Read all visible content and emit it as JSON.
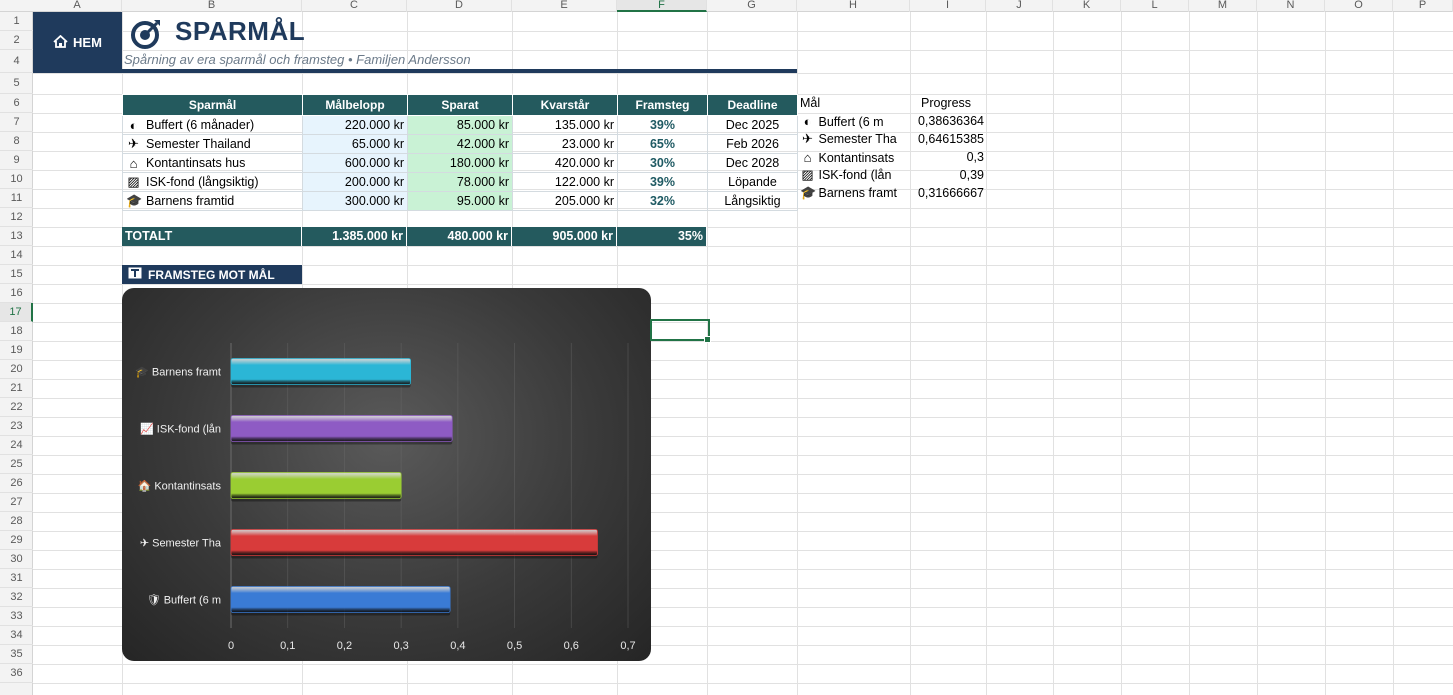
{
  "columns": [
    "A",
    "B",
    "C",
    "D",
    "E",
    "F",
    "G",
    "H",
    "I",
    "J",
    "K",
    "L",
    "M",
    "N",
    "O",
    "P"
  ],
  "selected_column": "F",
  "rows": [
    "1",
    "2",
    "4",
    "5",
    "6",
    "7",
    "8",
    "9",
    "10",
    "11",
    "12",
    "13",
    "14",
    "15",
    "16",
    "17",
    "18",
    "19",
    "20",
    "21",
    "22",
    "23",
    "24",
    "25",
    "26",
    "27",
    "28",
    "29",
    "30",
    "31",
    "32",
    "33",
    "34",
    "35",
    "36"
  ],
  "selected_row": "17",
  "header": {
    "home_label": "HEM",
    "home_icon": "home-icon",
    "title": "SPARMÅL",
    "title_icon": "target-icon",
    "subtitle": "Spårning av era sparmål och framsteg • Familjen Andersson"
  },
  "goals_table": {
    "headers": [
      "Sparmål",
      "Målbelopp",
      "Sparat",
      "Kvarstår",
      "Framsteg",
      "Deadline"
    ],
    "rows": [
      {
        "icon": "shield-icon",
        "glyph": "◐",
        "name": "Buffert (6 månader)",
        "target": "220.000 kr",
        "saved": "85.000 kr",
        "remaining": "135.000 kr",
        "progress": "39%",
        "deadline": "Dec 2025"
      },
      {
        "icon": "airplane-icon",
        "glyph": "✈",
        "name": "Semester Thailand",
        "target": "65.000 kr",
        "saved": "42.000 kr",
        "remaining": "23.000 kr",
        "progress": "65%",
        "deadline": "Feb 2026"
      },
      {
        "icon": "house-icon",
        "glyph": "⌂",
        "name": "Kontantinsats hus",
        "target": "600.000 kr",
        "saved": "180.000 kr",
        "remaining": "420.000 kr",
        "progress": "30%",
        "deadline": "Dec 2028"
      },
      {
        "icon": "chart-icon",
        "glyph": "▨",
        "name": "ISK-fond (långsiktig)",
        "target": "200.000 kr",
        "saved": "78.000 kr",
        "remaining": "122.000 kr",
        "progress": "39%",
        "deadline": "Löpande"
      },
      {
        "icon": "graduation-cap-icon",
        "glyph": "🎓",
        "name": "Barnens framtid",
        "target": "300.000 kr",
        "saved": "95.000 kr",
        "remaining": "205.000 kr",
        "progress": "32%",
        "deadline": "Långsiktig"
      }
    ]
  },
  "totals": {
    "label": "TOTALT",
    "target": "1.385.000 kr",
    "saved": "480.000 kr",
    "remaining": "905.000 kr",
    "progress": "35%"
  },
  "helper_table": {
    "headers": [
      "Mål",
      "Progress"
    ],
    "rows": [
      {
        "glyph": "◐",
        "name": "Buffert (6 m",
        "value": "0,38636364"
      },
      {
        "glyph": "✈",
        "name": "Semester Tha",
        "value": "0,64615385"
      },
      {
        "glyph": "⌂",
        "name": "Kontantinsats",
        "value": "0,3"
      },
      {
        "glyph": "▨",
        "name": "ISK-fond (lån",
        "value": "0,39"
      },
      {
        "glyph": "🎓",
        "name": "Barnens framt",
        "value": "0,31666667"
      }
    ]
  },
  "section": {
    "label": "FRAMSTEG MOT MÅL",
    "icon": "chart-box-icon"
  },
  "chart_data": {
    "type": "bar",
    "orientation": "horizontal",
    "categories": [
      "Buffert (6 m",
      "Semester Tha",
      "Kontantinsats",
      "ISK-fond (lån",
      "Barnens framt"
    ],
    "category_icons": [
      "🛡",
      "✈",
      "🏠",
      "📈",
      "🎓"
    ],
    "values": [
      0.38636364,
      0.64615385,
      0.3,
      0.39,
      0.31666667
    ],
    "colors": [
      "#3a7bd5",
      "#d83b3b",
      "#9acd32",
      "#8e5bc4",
      "#2bb6d6"
    ],
    "xlim": [
      0,
      0.7
    ],
    "xticks": [
      "0",
      "0,1",
      "0,2",
      "0,3",
      "0,4",
      "0,5",
      "0,6",
      "0,7"
    ],
    "grid": true,
    "title": "",
    "xlabel": "",
    "ylabel": ""
  }
}
